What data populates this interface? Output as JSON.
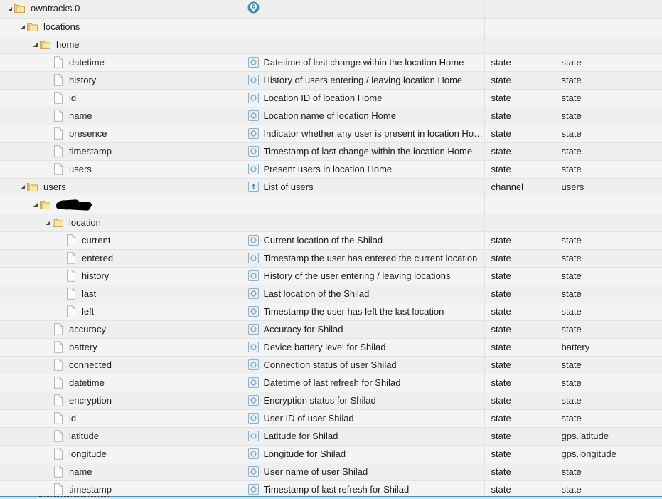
{
  "columns": {
    "name": "",
    "description": "",
    "role": "",
    "type": ""
  },
  "colors": {
    "row_background": "#efefef",
    "row_background_alt": "#f4f4f4",
    "selected_row": "#cfe8f7",
    "selection_border": "#3f93d0",
    "grid_line": "#e2e2e2",
    "folder_icon": "#f5cd6a",
    "object_icon": "#7fa8c4",
    "pin_icon": "#2c7fb0",
    "text": "#1c1c1c"
  },
  "rows": [
    {
      "name": "owntracks.0",
      "depth": 0,
      "kind": "folder",
      "expanded": true,
      "desc": "",
      "desc_icon": "map-pin-icon",
      "role": "",
      "type": ""
    },
    {
      "name": "locations",
      "depth": 1,
      "kind": "folder",
      "expanded": true,
      "desc": "",
      "desc_icon": "none",
      "role": "",
      "type": ""
    },
    {
      "name": "home",
      "depth": 2,
      "kind": "folder",
      "expanded": true,
      "desc": "",
      "desc_icon": "none",
      "role": "",
      "type": ""
    },
    {
      "name": "datetime",
      "depth": 3,
      "kind": "file",
      "expanded": false,
      "desc": "Datetime of last change within the location Home",
      "desc_icon": "state-icon",
      "role": "state",
      "type": "state"
    },
    {
      "name": "history",
      "depth": 3,
      "kind": "file",
      "expanded": false,
      "desc": "History of users entering / leaving location Home",
      "desc_icon": "state-icon",
      "role": "state",
      "type": "state"
    },
    {
      "name": "id",
      "depth": 3,
      "kind": "file",
      "expanded": false,
      "desc": "Location ID of location Home",
      "desc_icon": "state-icon",
      "role": "state",
      "type": "state"
    },
    {
      "name": "name",
      "depth": 3,
      "kind": "file",
      "expanded": false,
      "desc": "Location name of location Home",
      "desc_icon": "state-icon",
      "role": "state",
      "type": "state"
    },
    {
      "name": "presence",
      "depth": 3,
      "kind": "file",
      "expanded": false,
      "desc": "Indicator whether any user is present in location Ho…",
      "desc_icon": "state-icon",
      "role": "state",
      "type": "state"
    },
    {
      "name": "timestamp",
      "depth": 3,
      "kind": "file",
      "expanded": false,
      "desc": "Timestamp of last change within the location Home",
      "desc_icon": "state-icon",
      "role": "state",
      "type": "state"
    },
    {
      "name": "users",
      "depth": 3,
      "kind": "file",
      "expanded": false,
      "desc": "Present users in location Home",
      "desc_icon": "state-icon",
      "role": "state",
      "type": "state"
    },
    {
      "name": "users",
      "depth": 1,
      "kind": "folder",
      "expanded": true,
      "desc": "List of users",
      "desc_icon": "channel-icon",
      "role": "channel",
      "type": "users"
    },
    {
      "name": "",
      "depth": 2,
      "kind": "folder",
      "expanded": true,
      "redacted": true,
      "desc": "",
      "desc_icon": "none",
      "role": "",
      "type": ""
    },
    {
      "name": "location",
      "depth": 3,
      "kind": "folder",
      "expanded": true,
      "desc": "",
      "desc_icon": "none",
      "role": "",
      "type": ""
    },
    {
      "name": "current",
      "depth": 4,
      "kind": "file",
      "expanded": false,
      "desc": "Current location of the Shilad",
      "desc_icon": "state-icon",
      "role": "state",
      "type": "state"
    },
    {
      "name": "entered",
      "depth": 4,
      "kind": "file",
      "expanded": false,
      "desc": "Timestamp the user has entered the current location",
      "desc_icon": "state-icon",
      "role": "state",
      "type": "state"
    },
    {
      "name": "history",
      "depth": 4,
      "kind": "file",
      "expanded": false,
      "desc": "History of the user entering / leaving locations",
      "desc_icon": "state-icon",
      "role": "state",
      "type": "state"
    },
    {
      "name": "last",
      "depth": 4,
      "kind": "file",
      "expanded": false,
      "desc": "Last location of the Shilad",
      "desc_icon": "state-icon",
      "role": "state",
      "type": "state"
    },
    {
      "name": "left",
      "depth": 4,
      "kind": "file",
      "expanded": false,
      "desc": "Timestamp the user has left the last location",
      "desc_icon": "state-icon",
      "role": "state",
      "type": "state"
    },
    {
      "name": "accuracy",
      "depth": 3,
      "kind": "file",
      "expanded": false,
      "desc": "Accuracy for Shilad",
      "desc_icon": "state-icon",
      "role": "state",
      "type": "state"
    },
    {
      "name": "battery",
      "depth": 3,
      "kind": "file",
      "expanded": false,
      "desc": "Device battery level for Shilad",
      "desc_icon": "state-icon",
      "role": "state",
      "type": "battery"
    },
    {
      "name": "connected",
      "depth": 3,
      "kind": "file",
      "expanded": false,
      "desc": "Connection status of user Shilad",
      "desc_icon": "state-icon",
      "role": "state",
      "type": "state"
    },
    {
      "name": "datetime",
      "depth": 3,
      "kind": "file",
      "expanded": false,
      "desc": "Datetime of last refresh for Shilad",
      "desc_icon": "state-icon",
      "role": "state",
      "type": "state"
    },
    {
      "name": "encryption",
      "depth": 3,
      "kind": "file",
      "expanded": false,
      "desc": "Encryption status for Shilad",
      "desc_icon": "state-icon",
      "role": "state",
      "type": "state"
    },
    {
      "name": "id",
      "depth": 3,
      "kind": "file",
      "expanded": false,
      "desc": "User ID of user Shilad",
      "desc_icon": "state-icon",
      "role": "state",
      "type": "state"
    },
    {
      "name": "latitude",
      "depth": 3,
      "kind": "file",
      "expanded": false,
      "desc": "Latitude for Shilad",
      "desc_icon": "state-icon",
      "role": "state",
      "type": "gps.latitude"
    },
    {
      "name": "longitude",
      "depth": 3,
      "kind": "file",
      "expanded": false,
      "desc": "Longitude for Shilad",
      "desc_icon": "state-icon",
      "role": "state",
      "type": "gps.longitude"
    },
    {
      "name": "name",
      "depth": 3,
      "kind": "file",
      "expanded": false,
      "desc": "User name of user Shilad",
      "desc_icon": "state-icon",
      "role": "state",
      "type": "state"
    },
    {
      "name": "timestamp",
      "depth": 3,
      "kind": "file",
      "expanded": false,
      "desc": "Timestamp of last refresh for Shilad",
      "desc_icon": "state-icon",
      "role": "state",
      "type": "state"
    }
  ]
}
